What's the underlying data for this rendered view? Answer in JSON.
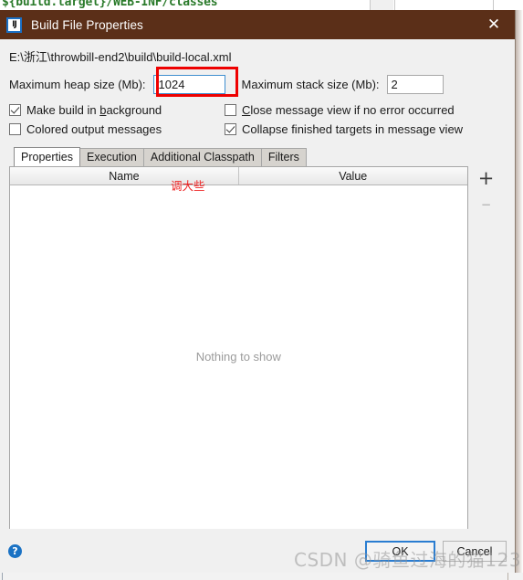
{
  "background": {
    "editor_text": "${build.target}/WEB-INF/classes"
  },
  "titlebar": {
    "icon": "intellij-idea-icon",
    "icon_text": "IJ",
    "title": "Build File Properties",
    "close_label": "✕"
  },
  "form": {
    "file_path": "E:\\浙江\\throwbill-end2\\build\\build-local.xml",
    "heap_label": "Maximum heap size (Mb):",
    "heap_value": "1024",
    "stack_label": "Maximum stack size (Mb):",
    "stack_value": "2"
  },
  "checkboxes": [
    {
      "label_a": "Make build in ",
      "mnemonic": "b",
      "label_b": "ackground",
      "checked": true
    },
    {
      "label_a": "",
      "mnemonic": "C",
      "label_b": "lose message view if no error occurred",
      "checked": false
    },
    {
      "label_a": "Colored output messages",
      "mnemonic": "",
      "label_b": "",
      "checked": false
    },
    {
      "label_a": "Collapse finished targets in message view",
      "mnemonic": "",
      "label_b": "",
      "checked": true
    }
  ],
  "tabs": [
    {
      "label": "Properties",
      "active": true
    },
    {
      "label": "Execution",
      "active": false
    },
    {
      "label": "Additional Classpath",
      "active": false
    },
    {
      "label": "Filters",
      "active": false
    }
  ],
  "table": {
    "columns": [
      "Name",
      "Value"
    ],
    "rows": [],
    "empty_text": "Nothing to show",
    "add_label": "+",
    "remove_label": "–"
  },
  "annotations": {
    "red_box_target": "heap-size-input",
    "red_text": "调大些",
    "red_color": "#ee0000"
  },
  "footer": {
    "help_label": "?",
    "ok_label": "OK",
    "cancel_label": "Cancel"
  },
  "watermark": {
    "text": "CSDN @骑鱼过海的猫123"
  }
}
